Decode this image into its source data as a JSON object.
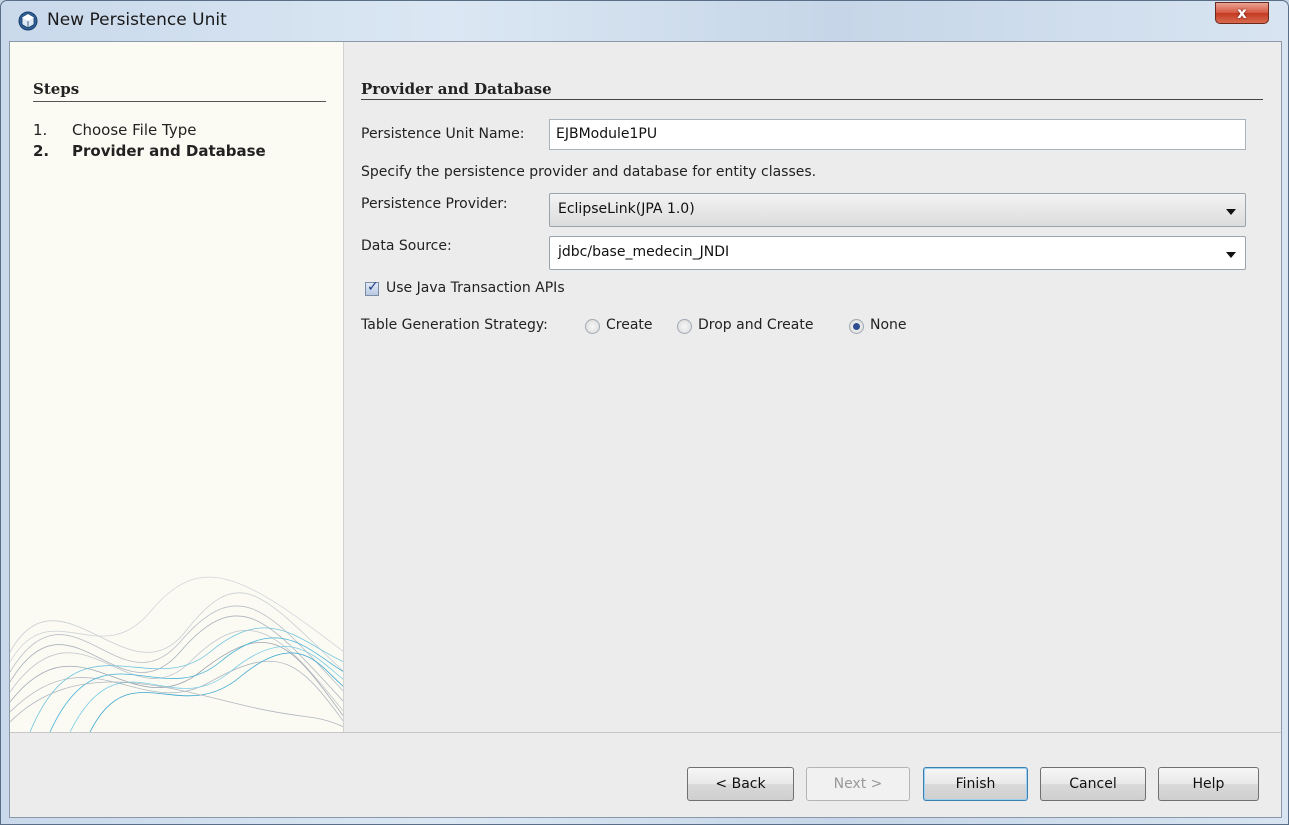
{
  "window": {
    "title": "New Persistence Unit",
    "close_label": "x"
  },
  "steps": {
    "heading": "Steps",
    "items": [
      {
        "num": "1.",
        "label": "Choose File Type"
      },
      {
        "num": "2.",
        "label": "Provider and Database"
      }
    ]
  },
  "panel": {
    "heading": "Provider and Database",
    "unit_name_label": "Persistence Unit Name:",
    "unit_name_value": "EJBModule1PU",
    "description": "Specify the persistence provider and database for entity classes.",
    "provider_label": "Persistence Provider:",
    "provider_value": "EclipseLink(JPA 1.0)",
    "datasource_label": "Data Source:",
    "datasource_value": "jdbc/base_medecin_JNDI",
    "use_jta_label": "Use Java Transaction APIs",
    "use_jta_checked": true,
    "strategy_label": "Table Generation Strategy:",
    "strategy_options": [
      "Create",
      "Drop and Create",
      "None"
    ],
    "strategy_selected": "None"
  },
  "buttons": {
    "back": "< Back",
    "next": "Next >",
    "finish": "Finish",
    "cancel": "Cancel",
    "help": "Help"
  }
}
